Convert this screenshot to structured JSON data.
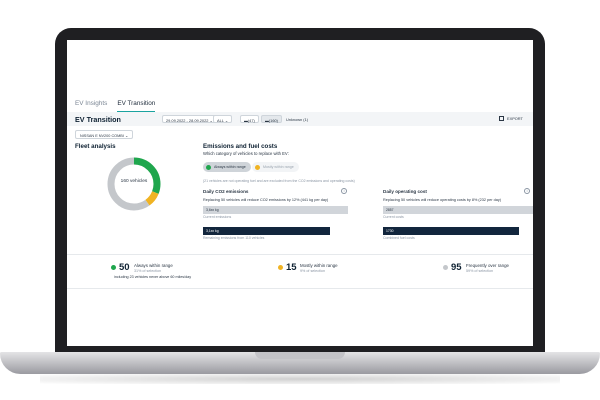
{
  "tabs": [
    {
      "label": "EV Insights",
      "active": false
    },
    {
      "label": "EV Transition",
      "active": true
    }
  ],
  "toolbar": {
    "title": "EV Transition",
    "date_range": "29.09.2022 - 28.09.2022",
    "filter_all": "ALL",
    "vehicle_count_a": "(47)",
    "vehicle_count_b": "(160)",
    "unknown": "Unknown (1)",
    "export_label": "EXPORT"
  },
  "model_filter": "NISSAN E NV200 COMBI",
  "fleet": {
    "title": "Fleet analysis",
    "center_label": "160 vehicles",
    "segments": [
      {
        "name": "Always within range",
        "share": 0.31,
        "color": "#1fa64d"
      },
      {
        "name": "Mostly within range",
        "share": 0.09,
        "color": "#f0b323"
      },
      {
        "name": "Frequently over range",
        "share": 0.6,
        "color": "#c4c7cb"
      }
    ]
  },
  "emissions": {
    "title": "Emissions and fuel costs",
    "question": "Which category of vehicles to replace with EV:",
    "toggle_on": "Always within range",
    "toggle_off": "Mostly within range",
    "excluded_note": "(21 vehicles are not operating fuel and are excluded from the CO2 emissions and operating costs)",
    "co2": {
      "title": "Daily CO2 emissions",
      "info": "i",
      "desc": "Replacing 50 vehicles will reduce CO2 emissions by 12% (441 kg per day)",
      "bar1_value": "3,6xx kg",
      "bar1_label": "Current emissions",
      "bar2_value": "3,1xx kg",
      "bar2_label": "Remaining emissions from 110 vehicles"
    },
    "cost": {
      "title": "Daily operating cost",
      "info": "i",
      "desc": "Replacing 50 vehicles will reduce operating costs by 8% (232 per day)",
      "bar1_value": "2857",
      "bar1_label": "Current costs",
      "bar2_value": "1730",
      "bar2_label": "Combined fuel costs"
    }
  },
  "stats": [
    {
      "value": "50",
      "label": "Always within range",
      "pct": "31% of selection",
      "note": "including 23 vehicles never above 60 miles/day",
      "color": "#1fa64d"
    },
    {
      "value": "15",
      "label": "Mostly within range",
      "pct": "9% of selection",
      "note": "",
      "color": "#f0b323"
    },
    {
      "value": "95",
      "label": "Frequently over range",
      "pct": "59% of selection",
      "note": "",
      "color": "#c4c7cb"
    }
  ]
}
